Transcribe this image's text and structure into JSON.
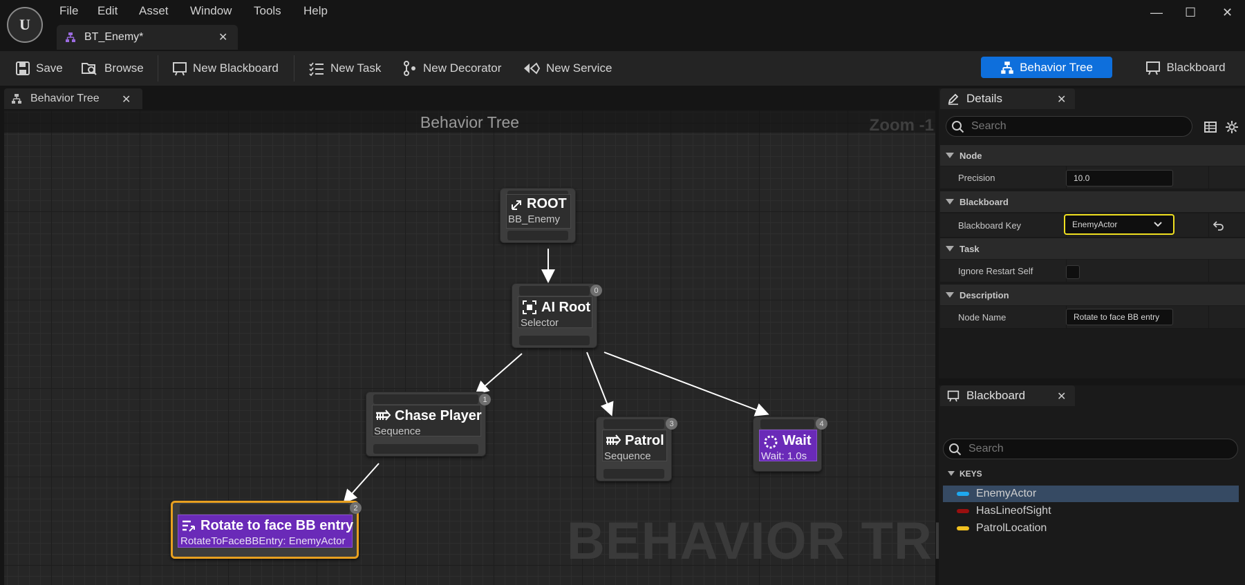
{
  "window": {
    "logo_text": "U",
    "menu": [
      "File",
      "Edit",
      "Asset",
      "Window",
      "Tools",
      "Help"
    ],
    "doc_tab": "BT_Enemy*",
    "controls": {
      "minimize": "—",
      "maximize": "☐",
      "close": "✕"
    }
  },
  "toolbar": {
    "save": "Save",
    "browse": "Browse",
    "new_blackboard": "New Blackboard",
    "new_task": "New Task",
    "new_decorator": "New Decorator",
    "new_service": "New Service",
    "mode_behavior_tree": "Behavior Tree",
    "mode_blackboard": "Blackboard"
  },
  "graph": {
    "tab_label": "Behavior Tree",
    "title": "Behavior Tree",
    "zoom": "Zoom -1",
    "watermark": "BEHAVIOR TREE",
    "nodes": [
      {
        "name": "ROOT",
        "sub": "BB_Enemy",
        "index": ""
      },
      {
        "name": "AI Root",
        "sub": "Selector",
        "index": "0"
      },
      {
        "name": "Chase Player",
        "sub": "Sequence",
        "index": "1"
      },
      {
        "name": "Patrol",
        "sub": "Sequence",
        "index": "3"
      },
      {
        "name": "Wait",
        "sub": "Wait: 1.0s",
        "index": "4"
      },
      {
        "name": "Rotate to face BB entry",
        "sub": "RotateToFaceBBEntry: EnemyActor",
        "index": "2"
      }
    ]
  },
  "details": {
    "tab_label": "Details",
    "search_placeholder": "Search",
    "categories": {
      "node": "Node",
      "blackboard": "Blackboard",
      "task": "Task",
      "description": "Description"
    },
    "precision_label": "Precision",
    "precision_value": "10.0",
    "bb_key_label": "Blackboard Key",
    "bb_key_value": "EnemyActor",
    "ignore_restart_label": "Ignore Restart Self",
    "ignore_restart_checked": false,
    "node_name_label": "Node Name",
    "node_name_value": "Rotate to face BB entry"
  },
  "blackboard": {
    "tab_label": "Blackboard",
    "search_placeholder": "Search",
    "keys_header": "KEYS",
    "keys": [
      {
        "name": "EnemyActor",
        "color": "#1ea8f0",
        "selected": true
      },
      {
        "name": "HasLineofSight",
        "color": "#9a0f0f",
        "selected": false
      },
      {
        "name": "PatrolLocation",
        "color": "#f0c020",
        "selected": false
      }
    ]
  },
  "colors": {
    "accent": "#0e6fdc",
    "selected_node_border": "#e8a020",
    "focus_field": "#f0e020",
    "task_node": "#6a2ab8"
  }
}
